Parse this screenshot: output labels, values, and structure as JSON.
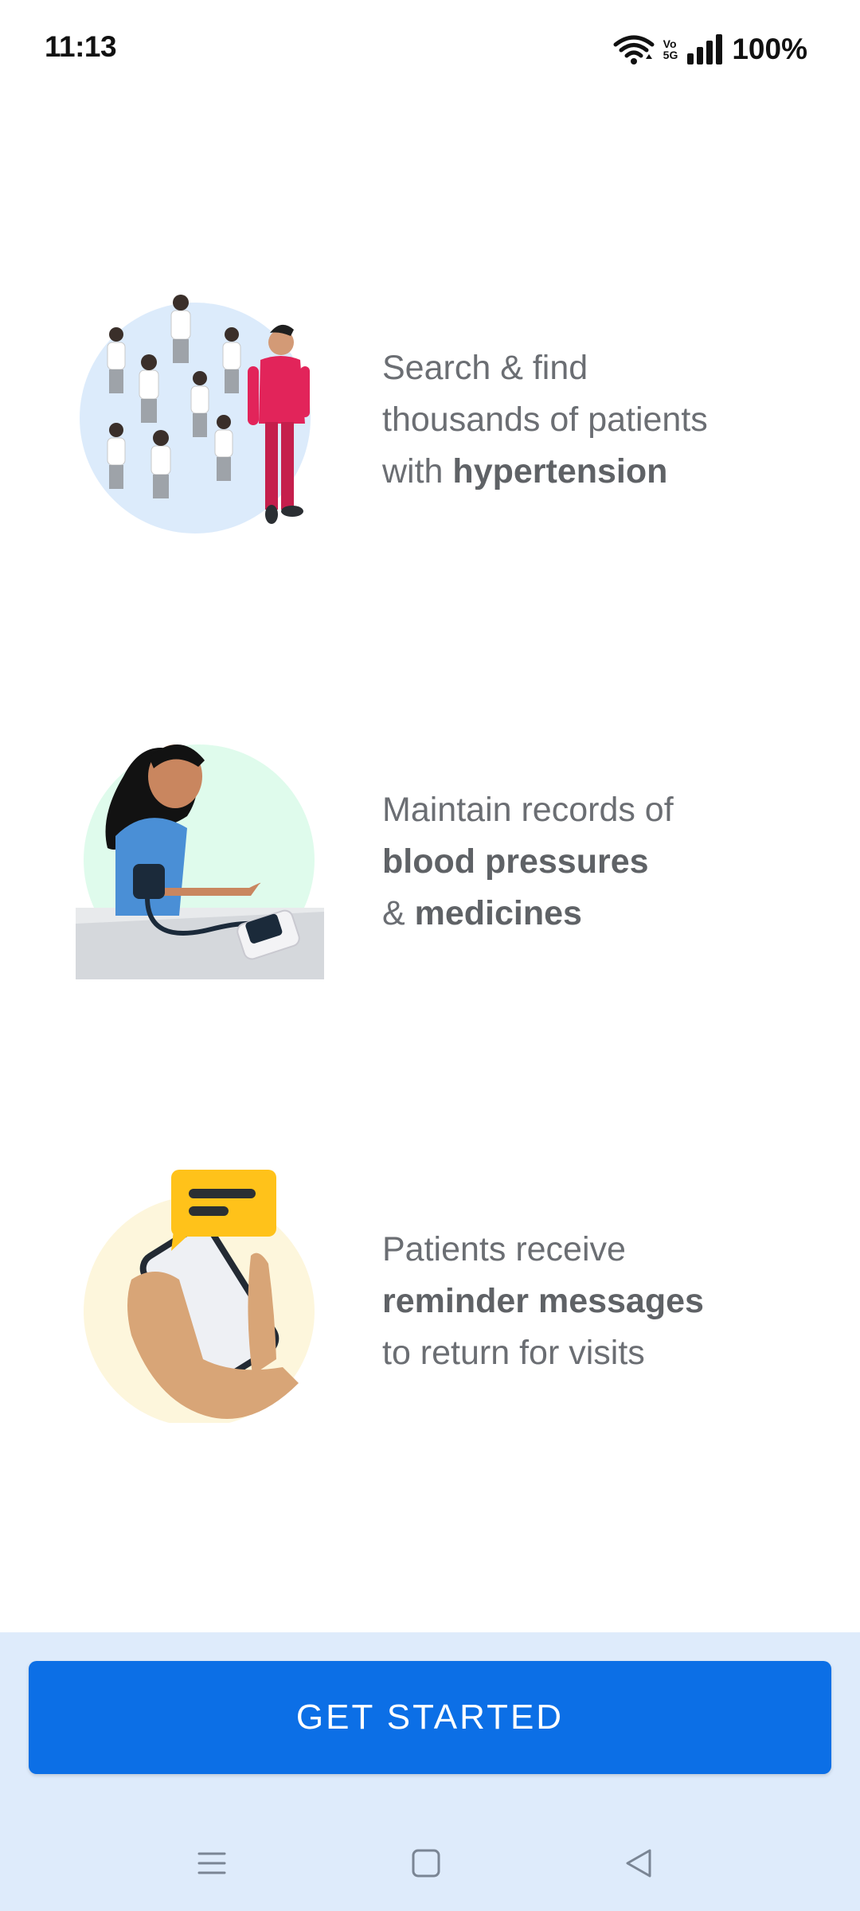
{
  "status_bar": {
    "time": "11:13",
    "battery": "100%",
    "volte_top": "Vo",
    "volte_bottom": "5G"
  },
  "features": [
    {
      "lines": [
        {
          "plain": "Search & find",
          "bold": ""
        },
        {
          "plain": "thousands of patients",
          "bold": ""
        },
        {
          "plain": "with ",
          "bold": "hypertension"
        }
      ],
      "illustration": "patients-crowd-illustration"
    },
    {
      "lines": [
        {
          "plain": "Maintain records of",
          "bold": ""
        },
        {
          "plain": "",
          "bold": "blood pressures"
        },
        {
          "plain": "& ",
          "bold": "medicines"
        }
      ],
      "illustration": "blood-pressure-illustration"
    },
    {
      "lines": [
        {
          "plain": "Patients receive",
          "bold": ""
        },
        {
          "plain": "",
          "bold": "reminder messages"
        },
        {
          "plain": "to return for visits",
          "bold": ""
        }
      ],
      "illustration": "reminder-message-illustration"
    }
  ],
  "cta": {
    "label": "GET STARTED"
  },
  "navbar": {
    "icons": [
      "menu-icon",
      "home-icon",
      "back-icon"
    ]
  },
  "colors": {
    "primary": "#0c6fe6",
    "panel": "#deebfb",
    "text": "#6b6e73"
  }
}
